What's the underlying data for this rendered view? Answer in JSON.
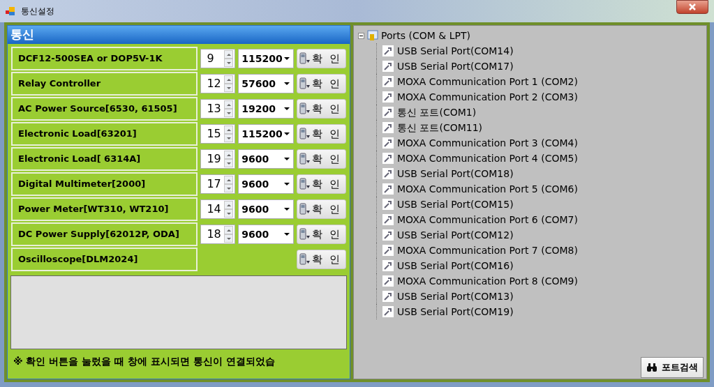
{
  "window": {
    "title": "통신설정"
  },
  "panel": {
    "title": "통신",
    "devices": [
      {
        "name": "DCF12-500SEA or DOP5V-1K",
        "port": "9",
        "baud": "115200",
        "button": "확  인"
      },
      {
        "name": "Relay Controller",
        "port": "12",
        "baud": "57600",
        "button": "확  인"
      },
      {
        "name": "AC Power Source[6530, 61505]",
        "port": "13",
        "baud": "19200",
        "button": "확  인"
      },
      {
        "name": "Electronic Load[63201]",
        "port": "15",
        "baud": "115200",
        "button": "확  인"
      },
      {
        "name": "Electronic Load[ 6314A]",
        "port": "19",
        "baud": "9600",
        "button": "확  인"
      },
      {
        "name": "Digital Multimeter[2000]",
        "port": "17",
        "baud": "9600",
        "button": "확  인"
      },
      {
        "name": "Power Meter[WT310, WT210]",
        "port": "14",
        "baud": "9600",
        "button": "확  인"
      },
      {
        "name": "DC Power Supply[62012P, ODA]",
        "port": "18",
        "baud": "9600",
        "button": "확  인"
      },
      {
        "name": "Oscilloscope[DLM2024]",
        "button": "확  인"
      }
    ],
    "note": "※ 확인 버튼을 눌렀을 때 창에 표시되면 통신이 연결되었습"
  },
  "ports_tree": {
    "label": "Ports (COM & LPT)",
    "expanded": true,
    "children": [
      {
        "label": "USB Serial Port(COM14)"
      },
      {
        "label": "USB Serial Port(COM17)"
      },
      {
        "label": "MOXA Communication Port 1 (COM2)"
      },
      {
        "label": "MOXA Communication Port 2 (COM3)"
      },
      {
        "label": "통신 포트(COM1)"
      },
      {
        "label": "통신 포트(COM11)"
      },
      {
        "label": "MOXA Communication Port 3 (COM4)"
      },
      {
        "label": "MOXA Communication Port 4 (COM5)"
      },
      {
        "label": "USB Serial Port(COM18)"
      },
      {
        "label": "MOXA Communication Port 5 (COM6)"
      },
      {
        "label": "USB Serial Port(COM15)"
      },
      {
        "label": "MOXA Communication Port 6 (COM7)"
      },
      {
        "label": "USB Serial Port(COM12)"
      },
      {
        "label": "MOXA Communication Port 7 (COM8)"
      },
      {
        "label": "USB Serial Port(COM16)"
      },
      {
        "label": "MOXA Communication Port 8 (COM9)"
      },
      {
        "label": "USB Serial Port(COM13)"
      },
      {
        "label": "USB Serial Port(COM19)"
      }
    ]
  },
  "search_button": "포트검색"
}
